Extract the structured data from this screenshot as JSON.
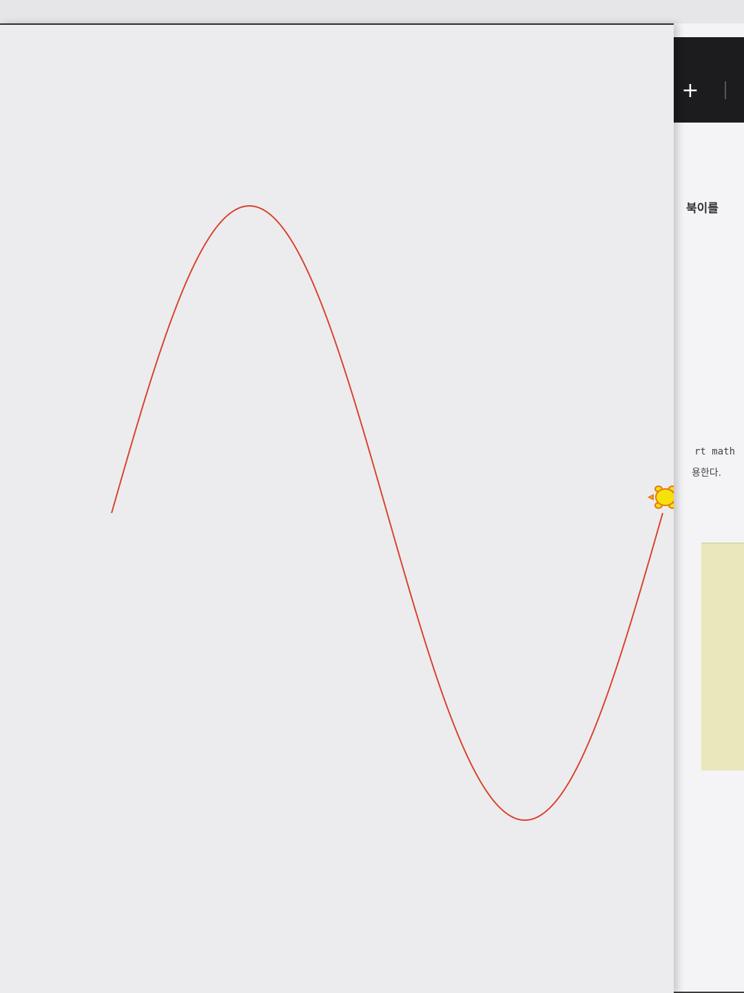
{
  "background_window": {
    "new_tab_icon": "plus-icon",
    "text_line_1": "북이를",
    "code_fragment": "rt math",
    "text_line_2": "용한다."
  },
  "turtle_window": {
    "canvas_color": "#ececee",
    "pen_color": "#d9412b",
    "turtle_fill_color": "#f5e20a",
    "turtle_outline_color": "#e8761a",
    "turtle_icon": "turtle-icon",
    "drawing": "sine wave, one full period"
  }
}
